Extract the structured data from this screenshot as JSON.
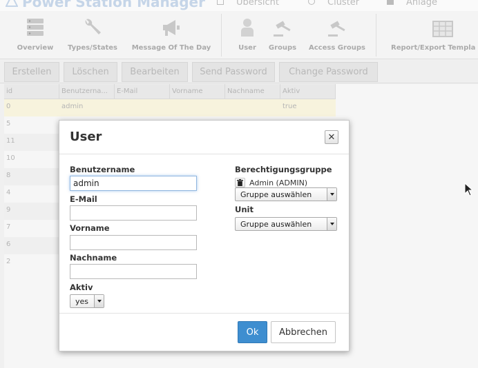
{
  "app": {
    "title": "Power Station Manager"
  },
  "topnav": [
    {
      "label": "Übersicht"
    },
    {
      "label": "Cluster"
    },
    {
      "label": "Anlage"
    }
  ],
  "ribbon": [
    {
      "label": "Overview",
      "icon": "database-icon"
    },
    {
      "label": "Types/States",
      "icon": "wrench-icon"
    },
    {
      "label": "Message Of The Day",
      "icon": "megaphone-icon"
    },
    {
      "label": "User",
      "icon": "user-icon"
    },
    {
      "label": "Groups",
      "icon": "gavel-icon"
    },
    {
      "label": "Access Groups",
      "icon": "gavel-icon"
    },
    {
      "label": "Report/Export Templa",
      "icon": "spreadsheet-icon"
    }
  ],
  "actions": [
    {
      "label": "Erstellen"
    },
    {
      "label": "Löschen"
    },
    {
      "label": "Bearbeiten"
    },
    {
      "label": "Send Password"
    },
    {
      "label": "Change Password"
    }
  ],
  "grid": {
    "columns": [
      "id",
      "Benutzerna...",
      "E-Mail",
      "Vorname",
      "Nachname",
      "Aktiv"
    ],
    "rows": [
      {
        "id": "0",
        "name": "admin",
        "aktiv": "true"
      },
      {
        "id": "5"
      },
      {
        "id": "11"
      },
      {
        "id": "10"
      },
      {
        "id": "8"
      },
      {
        "id": "4"
      },
      {
        "id": "9"
      },
      {
        "id": "7"
      },
      {
        "id": "6"
      },
      {
        "id": "2"
      }
    ]
  },
  "dialog": {
    "title": "User",
    "close_icon": "close-icon",
    "fields": {
      "username": {
        "label": "Benutzername",
        "value": "admin"
      },
      "email": {
        "label": "E-Mail",
        "value": ""
      },
      "firstname": {
        "label": "Vorname",
        "value": ""
      },
      "lastname": {
        "label": "Nachname",
        "value": ""
      },
      "active": {
        "label": "Aktiv",
        "value": "yes"
      }
    },
    "permission_group": {
      "label": "Berechtigungsgruppe",
      "item": "Admin (ADMIN)",
      "select_value": "Gruppe auswählen"
    },
    "unit": {
      "label": "Unit",
      "select_value": "Gruppe auswählen"
    },
    "ok_label": "Ok",
    "cancel_label": "Abbrechen"
  },
  "colors": {
    "primary": "#3e8ed0",
    "selected_row": "#f7f3dd"
  }
}
